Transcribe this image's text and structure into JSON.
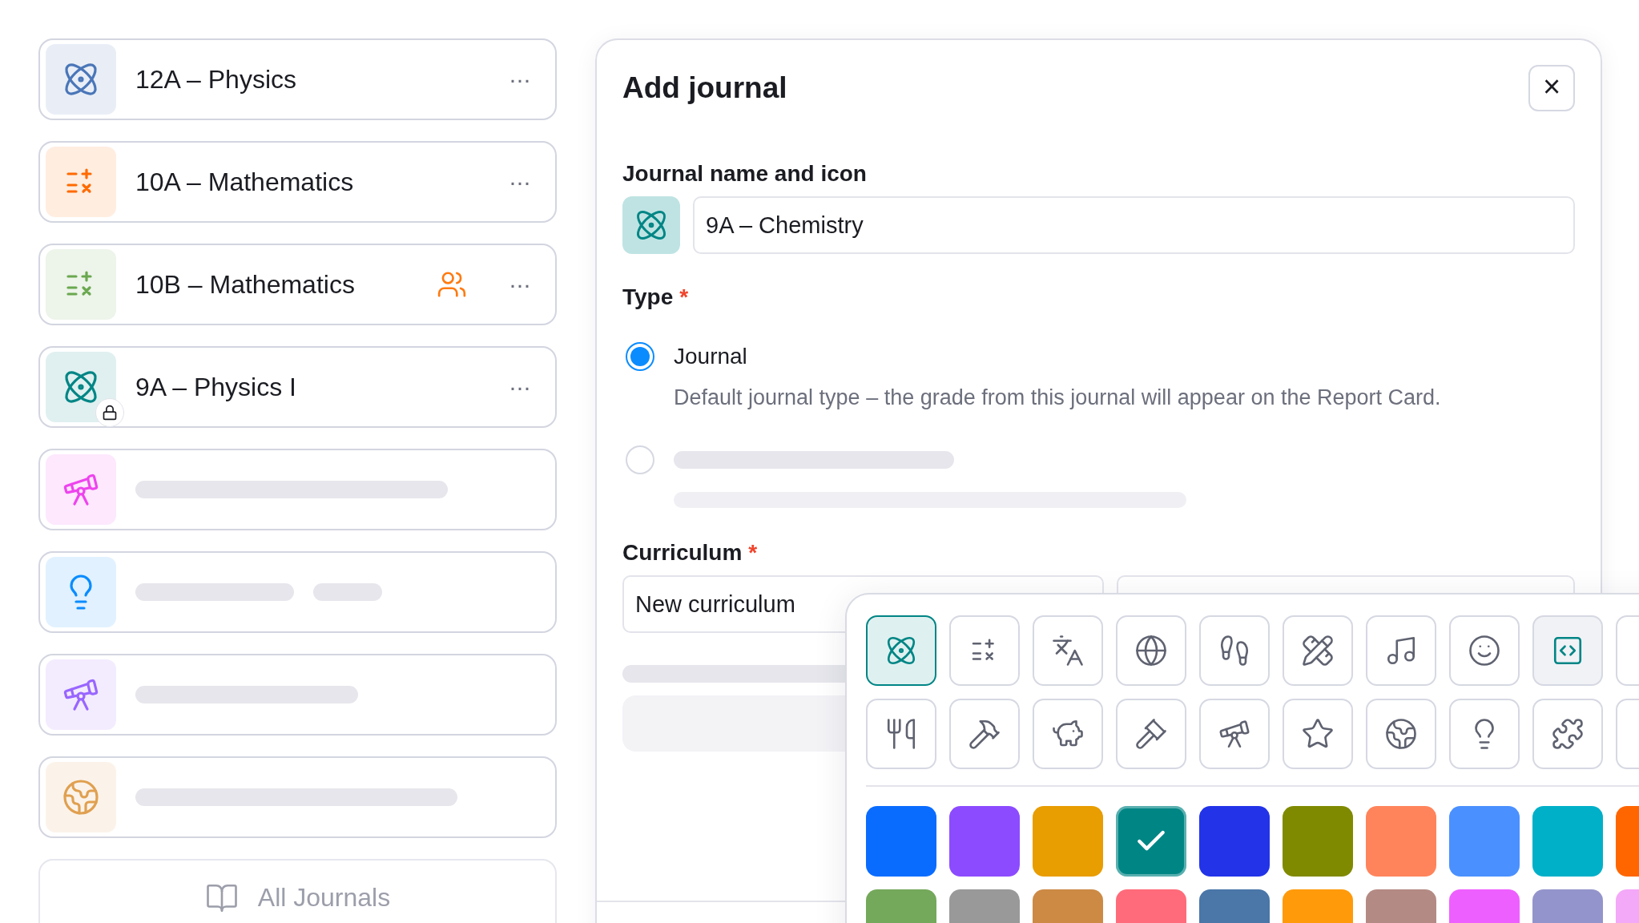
{
  "journals": [
    {
      "kind": "journal",
      "title": "12A – Physics",
      "color": "#4a76b8",
      "shared": false,
      "locked": false,
      "menu": "···"
    },
    {
      "kind": "journal",
      "title": "10A – Mathematics",
      "color": "#ff6a00",
      "shared": false,
      "locked": false,
      "menu": "···"
    },
    {
      "kind": "journal",
      "title": "10B – Mathematics",
      "color": "#6aa84f",
      "shared": true,
      "locked": false,
      "menu": "···"
    },
    {
      "kind": "journal",
      "title": "9A – Physics I",
      "color": "#008585",
      "shared": false,
      "locked": true,
      "menu": "···"
    },
    {
      "kind": "skeleton",
      "color": "#ee44ee"
    },
    {
      "kind": "skeleton",
      "color": "#0a8cff"
    },
    {
      "kind": "skeleton",
      "color": "#9966ff"
    },
    {
      "kind": "skeleton",
      "color": "#e0a050"
    }
  ],
  "all_journals": "All Journals",
  "dialog": {
    "title": "Add journal",
    "close": "×",
    "name_label": "Journal name and icon",
    "name_value": "9A – Chemistry",
    "type_label": "Type",
    "required_mark": "*",
    "type_options": [
      {
        "kind": "option",
        "label": "Journal",
        "description": "Default journal type – the grade from this journal will appear on the Report Card.",
        "selected": true
      },
      {
        "kind": "skeleton",
        "selected": false
      }
    ],
    "curriculum_label": "Curriculum",
    "curriculum_value": "New curriculum"
  },
  "picker": {
    "icons": [
      {
        "selected": true,
        "highlighted": false
      },
      {
        "selected": false,
        "highlighted": false
      },
      {
        "selected": false,
        "highlighted": false
      },
      {
        "selected": false,
        "highlighted": false
      },
      {
        "selected": false,
        "highlighted": false
      },
      {
        "selected": false,
        "highlighted": false
      },
      {
        "selected": false,
        "highlighted": false
      },
      {
        "selected": false,
        "highlighted": false
      },
      {
        "selected": false,
        "highlighted": true
      },
      {
        "selected": false,
        "highlighted": false
      },
      {
        "selected": false,
        "highlighted": false
      },
      {
        "selected": false,
        "highlighted": false
      },
      {
        "selected": false,
        "highlighted": false
      },
      {
        "selected": false,
        "highlighted": false
      },
      {
        "selected": false,
        "highlighted": false
      },
      {
        "selected": false,
        "highlighted": false
      },
      {
        "selected": false,
        "highlighted": false
      },
      {
        "selected": false,
        "highlighted": false
      },
      {
        "selected": false,
        "highlighted": false
      },
      {
        "selected": false,
        "highlighted": false
      }
    ],
    "colors": [
      {
        "color": "#0a6cff",
        "selected": false
      },
      {
        "color": "#8c4bff",
        "selected": false
      },
      {
        "color": "#e89d00",
        "selected": false
      },
      {
        "color": "#008585",
        "selected": true
      },
      {
        "color": "#2233e8",
        "selected": false
      },
      {
        "color": "#808a00",
        "selected": false
      },
      {
        "color": "#ff845c",
        "selected": false
      },
      {
        "color": "#4a90ff",
        "selected": false
      },
      {
        "color": "#00b0c8",
        "selected": false
      },
      {
        "color": "#ff6600",
        "selected": false
      },
      {
        "color": "#74a85a",
        "selected": false
      },
      {
        "color": "#999999",
        "selected": false
      },
      {
        "color": "#cc8a45",
        "selected": false
      },
      {
        "color": "#ff6b7a",
        "selected": false
      },
      {
        "color": "#4a76a8",
        "selected": false
      },
      {
        "color": "#ff9a0a",
        "selected": false
      },
      {
        "color": "#b48a84",
        "selected": false
      },
      {
        "color": "#ee5fff",
        "selected": false
      },
      {
        "color": "#9494cc",
        "selected": false
      },
      {
        "color": "#f4a8f8",
        "selected": false
      }
    ]
  }
}
